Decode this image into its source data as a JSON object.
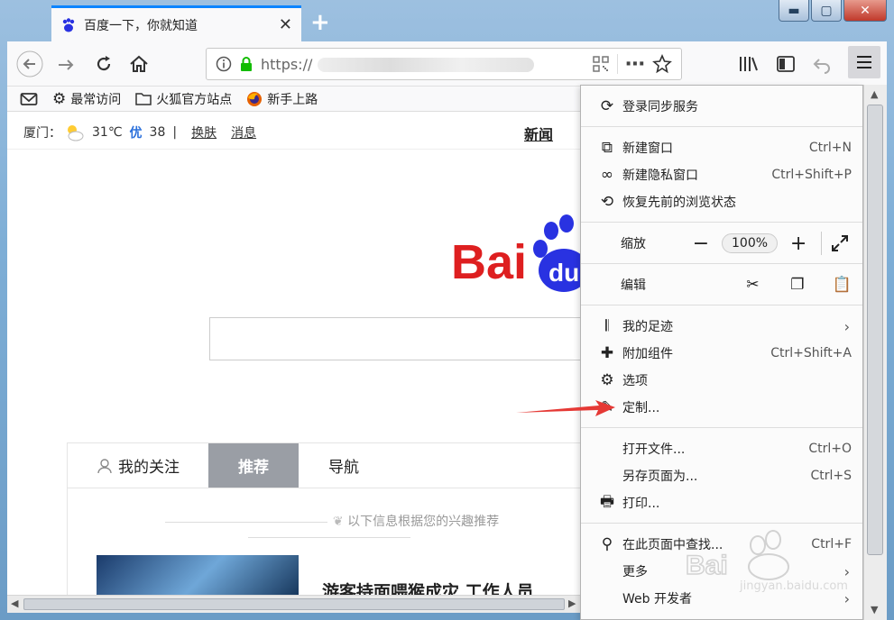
{
  "window": {
    "minimize_glyph": "▬",
    "maximize_glyph": "▢",
    "close_glyph": "✕"
  },
  "tab": {
    "title": "百度一下，你就知道",
    "close_glyph": "✕",
    "new_tab_glyph": "+"
  },
  "toolbar": {
    "url_prefix": "https://",
    "zoom_glyph": "⋯"
  },
  "bookmarks": [
    {
      "icon": "gear-icon",
      "label": "最常访问"
    },
    {
      "icon": "folder-icon",
      "label": "火狐官方站点"
    },
    {
      "icon": "firefox-icon",
      "label": "新手上路"
    }
  ],
  "page": {
    "city": "厦门：",
    "temperature": "31℃",
    "aqi_label": "优",
    "aqi_value": "38",
    "divider": "|",
    "skin_link": "换肤",
    "message_link": "消息",
    "news_link": "新闻",
    "feed_tabs": {
      "follow": "我的关注",
      "recommend": "推荐",
      "navigation": "导航"
    },
    "feed_hint": "以下信息根据您的兴趣推荐",
    "feed_title": "游客持面喂猴成灾 工作人员"
  },
  "menu": {
    "sync": "登录同步服务",
    "new_window": {
      "label": "新建窗口",
      "shortcut": "Ctrl+N"
    },
    "private_window": {
      "label": "新建隐私窗口",
      "shortcut": "Ctrl+Shift+P"
    },
    "restore": "恢复先前的浏览状态",
    "zoom": {
      "label": "缩放",
      "minus": "−",
      "value": "100%",
      "plus": "+"
    },
    "edit": "编辑",
    "library": "我的足迹",
    "addons": {
      "label": "附加组件",
      "shortcut": "Ctrl+Shift+A"
    },
    "options": "选项",
    "customize": "定制...",
    "open_file": {
      "label": "打开文件...",
      "shortcut": "Ctrl+O"
    },
    "save_page": {
      "label": "另存页面为...",
      "shortcut": "Ctrl+S"
    },
    "print": "打印...",
    "find": {
      "label": "在此页面中查找...",
      "shortcut": "Ctrl+F"
    },
    "more": "更多",
    "web_dev": "Web 开发者",
    "chevron": "›"
  },
  "watermark": {
    "site": "jingyan.baidu.com"
  },
  "colors": {
    "accent": "#0a84ff",
    "baidu_red": "#de1f20",
    "baidu_blue": "#2932e1",
    "annotation_red": "#e53935"
  }
}
